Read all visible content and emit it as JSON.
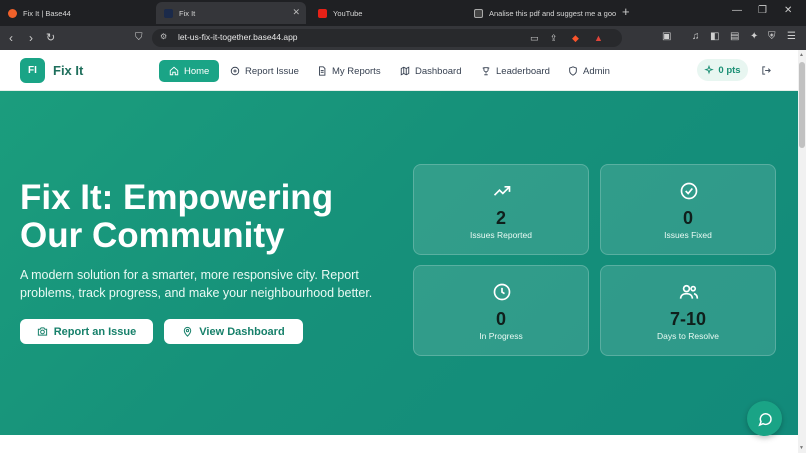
{
  "browser": {
    "tabs": [
      {
        "title": "Fix It | Base44"
      },
      {
        "title": "Fix It"
      },
      {
        "title": "YouTube"
      },
      {
        "title": "Analise this pdf and suggest me a good team"
      }
    ],
    "url": "let-us-fix-it-together.base44.app"
  },
  "app": {
    "logo_initials": "FI",
    "logo_name": "Fix It",
    "nav": [
      {
        "label": "Home",
        "icon": "home-icon"
      },
      {
        "label": "Report Issue",
        "icon": "plus-circle-icon"
      },
      {
        "label": "My Reports",
        "icon": "document-icon"
      },
      {
        "label": "Dashboard",
        "icon": "map-icon"
      },
      {
        "label": "Leaderboard",
        "icon": "trophy-icon"
      },
      {
        "label": "Admin",
        "icon": "shield-icon"
      }
    ],
    "points": "0 pts"
  },
  "hero": {
    "title": "Fix It: Empowering Our Community",
    "subtitle": "A modern solution for a smarter, more responsive city. Report problems, track progress, and make your neighbourhood better.",
    "report_button": "Report an Issue",
    "dashboard_button": "View Dashboard"
  },
  "stats": [
    {
      "value": "2",
      "label": "Issues Reported",
      "icon": "trending-up-icon"
    },
    {
      "value": "0",
      "label": "Issues Fixed",
      "icon": "check-circle-icon"
    },
    {
      "value": "0",
      "label": "In Progress",
      "icon": "clock-icon"
    },
    {
      "value": "7-10",
      "label": "Days to Resolve",
      "icon": "users-icon"
    }
  ],
  "colors": {
    "primary": "#1aa486",
    "hero_start": "#1b9d7d",
    "hero_end": "#128a7a"
  }
}
